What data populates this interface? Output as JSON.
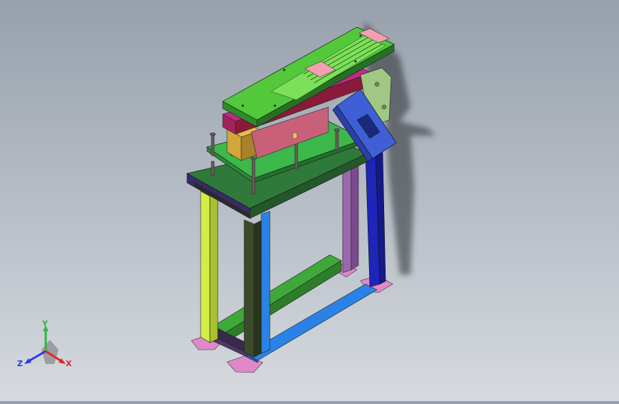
{
  "viewport": {
    "background_top": "#97a0ac",
    "background_bottom": "#d6dadf"
  },
  "model": {
    "parts": [
      {
        "name": "frame-left-front-leg",
        "color": "#cce63a"
      },
      {
        "name": "frame-front-leg",
        "color": "#3a4a2a"
      },
      {
        "name": "frame-right-rear-leg",
        "color": "#8e5aa0"
      },
      {
        "name": "frame-right-post",
        "color": "#1e25b8"
      },
      {
        "name": "bottom-rail-front",
        "color": "#2a82e6"
      },
      {
        "name": "bottom-rail-rear",
        "color": "#3fa83a"
      },
      {
        "name": "table-top-plate",
        "color": "#2f7a3a"
      },
      {
        "name": "mounting-plate",
        "color": "#3db84a"
      },
      {
        "name": "cylinder-block",
        "color": "#d2a63a"
      },
      {
        "name": "pink-block",
        "color": "#c8607a"
      },
      {
        "name": "feeder-tray",
        "color": "#52c83a"
      },
      {
        "name": "chute",
        "color": "#3f5fd6"
      },
      {
        "name": "side-bracket",
        "color": "#a0c884"
      },
      {
        "name": "foot-pad",
        "color": "#e088c8"
      }
    ]
  },
  "triad": {
    "x_label": "X",
    "y_label": "Y",
    "z_label": "Z",
    "x_color": "#e0252a",
    "y_color": "#2fb83a",
    "z_color": "#2a3ae0"
  }
}
